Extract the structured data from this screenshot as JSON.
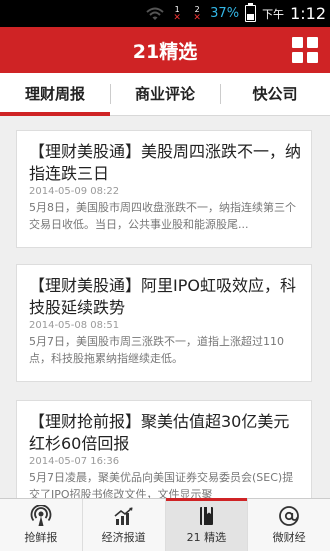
{
  "status_bar": {
    "battery_percent": "37%",
    "ampm": "下午",
    "time": "1:12",
    "sim1": "1",
    "sim2": "2",
    "icons": [
      "wifi-icon",
      "sim1-no-signal-icon",
      "sim2-no-signal-icon",
      "battery-icon"
    ]
  },
  "app_bar": {
    "title": "21精选",
    "menu_icon": "grid-menu-icon"
  },
  "tabs": [
    {
      "label": "理财周报",
      "active": true
    },
    {
      "label": "商业评论",
      "active": false
    },
    {
      "label": "快公司",
      "active": false
    }
  ],
  "articles": [
    {
      "title": "【理财美股通】美股周四涨跌不一，纳指连跌三日",
      "date": "2014-05-09 08:22",
      "summary": "5月8日，美国股市周四收盘涨跌不一，纳指连续第三个交易日收低。当日，公共事业股和能源股尾..."
    },
    {
      "title": "【理财美股通】阿里IPO虹吸效应，科技股延续跌势",
      "date": "2014-05-08 08:51",
      "summary": "5月7日，美国股市周三涨跌不一，道指上涨超过110点，科技股拖累纳指继续走低。"
    },
    {
      "title": "【理财抢前报】聚美估值超30亿美元红杉60倍回报",
      "date": "2014-05-07 16:36",
      "summary": "5月7日凌晨，聚美优品向美国证券交易委员会(SEC)提交了IPO招股书修改文件，文件显示聚"
    }
  ],
  "bottom_nav": [
    {
      "label": "抢鲜报",
      "icon": "broadcast-icon",
      "active": false
    },
    {
      "label": "经济报道",
      "icon": "bar-chart-icon",
      "active": false
    },
    {
      "label": "21 精选",
      "icon": "bookmark-book-icon",
      "active": true
    },
    {
      "label": "微财经",
      "icon": "at-sign-icon",
      "active": false
    }
  ],
  "colors": {
    "brand_red": "#cf2325",
    "status_blue": "#33b5e5"
  }
}
